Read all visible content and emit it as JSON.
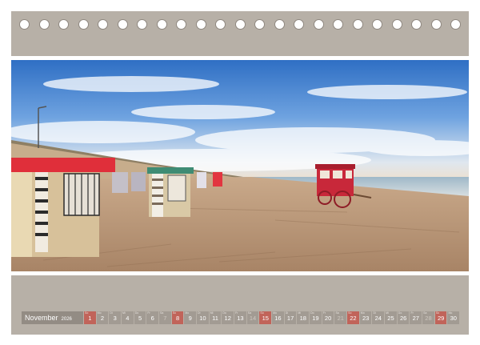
{
  "calendar": {
    "month": "November",
    "year": "2026",
    "days": [
      {
        "num": "1",
        "dow": "So",
        "type": "holiday"
      },
      {
        "num": "2",
        "dow": "Mo",
        "type": "normal"
      },
      {
        "num": "3",
        "dow": "Di",
        "type": "normal"
      },
      {
        "num": "4",
        "dow": "Mi",
        "type": "normal"
      },
      {
        "num": "5",
        "dow": "Do",
        "type": "normal"
      },
      {
        "num": "6",
        "dow": "Fr",
        "type": "normal"
      },
      {
        "num": "7",
        "dow": "Sa",
        "type": "weekend"
      },
      {
        "num": "8",
        "dow": "So",
        "type": "holiday"
      },
      {
        "num": "9",
        "dow": "Mo",
        "type": "normal"
      },
      {
        "num": "10",
        "dow": "Di",
        "type": "normal"
      },
      {
        "num": "11",
        "dow": "Mi",
        "type": "normal"
      },
      {
        "num": "12",
        "dow": "Do",
        "type": "normal"
      },
      {
        "num": "13",
        "dow": "Fr",
        "type": "normal"
      },
      {
        "num": "14",
        "dow": "Sa",
        "type": "weekend"
      },
      {
        "num": "15",
        "dow": "So",
        "type": "holiday"
      },
      {
        "num": "16",
        "dow": "Mo",
        "type": "normal"
      },
      {
        "num": "17",
        "dow": "Di",
        "type": "normal"
      },
      {
        "num": "18",
        "dow": "Mi",
        "type": "normal"
      },
      {
        "num": "19",
        "dow": "Do",
        "type": "normal"
      },
      {
        "num": "20",
        "dow": "Fr",
        "type": "normal"
      },
      {
        "num": "21",
        "dow": "Sa",
        "type": "weekend"
      },
      {
        "num": "22",
        "dow": "So",
        "type": "holiday"
      },
      {
        "num": "23",
        "dow": "Mo",
        "type": "normal"
      },
      {
        "num": "24",
        "dow": "Di",
        "type": "normal"
      },
      {
        "num": "25",
        "dow": "Mi",
        "type": "normal"
      },
      {
        "num": "26",
        "dow": "Do",
        "type": "normal"
      },
      {
        "num": "27",
        "dow": "Fr",
        "type": "normal"
      },
      {
        "num": "28",
        "dow": "Sa",
        "type": "weekend"
      },
      {
        "num": "29",
        "dow": "So",
        "type": "holiday"
      },
      {
        "num": "30",
        "dow": "Mo",
        "type": "normal"
      }
    ]
  },
  "colors": {
    "page_background": "#b7b0a7",
    "cell_background": "#a29b93",
    "holiday_cell": "#c1645a",
    "month_label_background": "#938c84"
  },
  "rings": {
    "count": 23
  }
}
